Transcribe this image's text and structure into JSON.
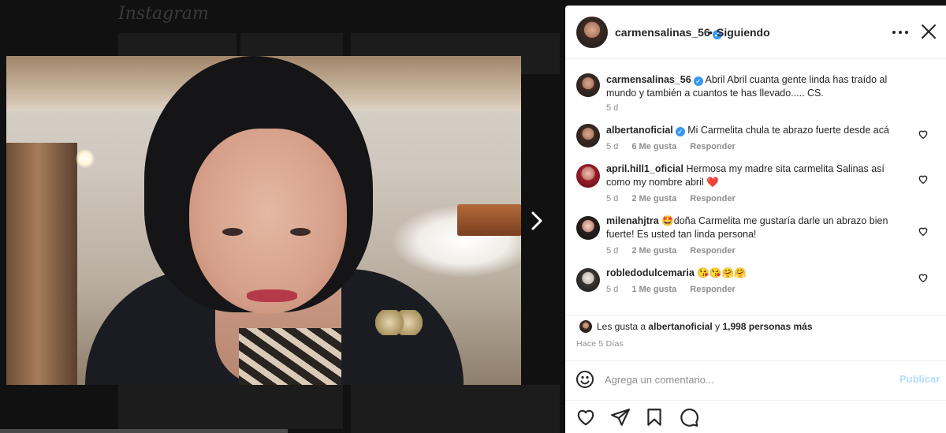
{
  "background": {
    "logo": "Instagram"
  },
  "post": {
    "next_icon": "chevron-right-icon"
  },
  "header": {
    "username": "carmensalinas_56",
    "separator": "•",
    "follow_status": "Siguiendo",
    "more_icon": "more-horizontal-icon",
    "close_icon": "close-icon"
  },
  "caption": {
    "username": "carmensalinas_56",
    "text": "Abril Abril cuanta gente linda has traído al mundo y también a cuantos te has llevado..... CS.",
    "time": "5 d"
  },
  "comments": [
    {
      "username": "albertanoficial",
      "verified": true,
      "text": "Mi Carmelita chula te abrazo fuerte desde acá",
      "time": "5 d",
      "likes": "6 Me gusta",
      "reply": "Responder"
    },
    {
      "username": "april.hill1_oficial",
      "verified": false,
      "text": "Hermosa my madre sita carmelita Salinas así como my nombre abril ❤️",
      "time": "5 d",
      "likes": "2 Me gusta",
      "reply": "Responder"
    },
    {
      "username": "milenahjtra",
      "verified": false,
      "text": "🤩doña Carmelita me gustaría darle un abrazo bien fuerte! Es usted tan linda persona!",
      "time": "5 d",
      "likes": "2 Me gusta",
      "reply": "Responder"
    },
    {
      "username": "robledodulcemaria",
      "verified": false,
      "text": "😘😘🤗🤗",
      "time": "5 d",
      "likes": "1 Me gusta",
      "reply": "Responder"
    }
  ],
  "likes_summary": {
    "prefix": "Les gusta a",
    "user": "albertanoficial",
    "connector": "y",
    "others": "1,998 personas más"
  },
  "posted_ago": "Hace 5 Días",
  "composer": {
    "placeholder": "Agrega un comentario...",
    "publish_label": "Publicar"
  },
  "colors": {
    "verified": "#3897f0",
    "publish_disabled": "#b2dffc",
    "overlay": "#111111"
  }
}
